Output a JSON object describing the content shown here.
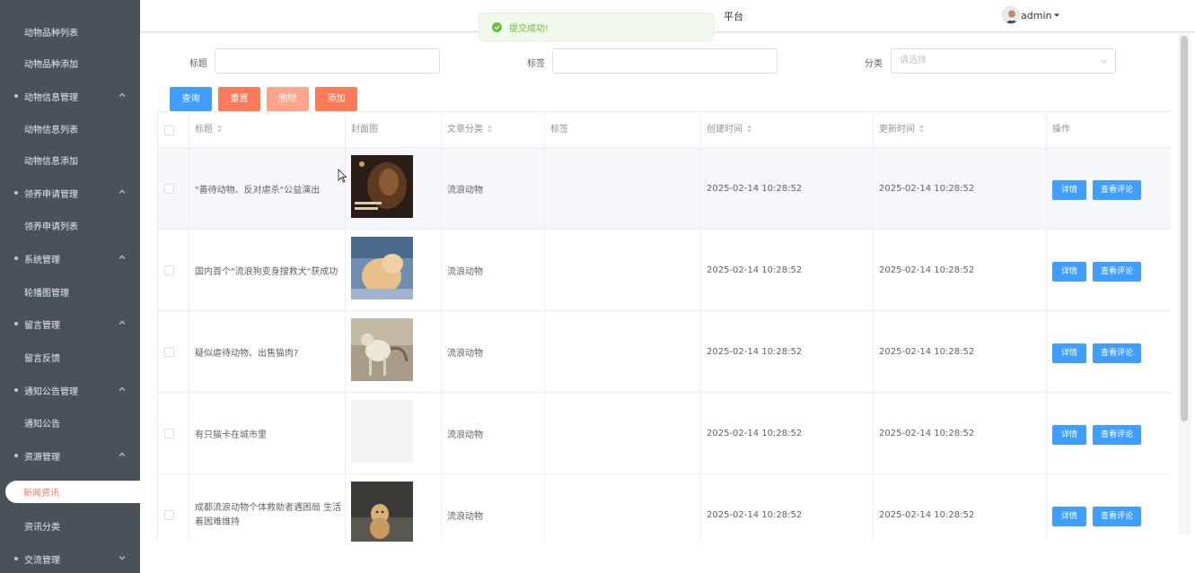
{
  "sidebar": {
    "items": [
      {
        "type": "sub",
        "label": "动物品种列表"
      },
      {
        "type": "sub",
        "label": "动物品种添加"
      },
      {
        "type": "group",
        "label": "动物信息管理"
      },
      {
        "type": "sub",
        "label": "动物信息列表"
      },
      {
        "type": "sub",
        "label": "动物信息添加"
      },
      {
        "type": "group",
        "label": "领养申请管理"
      },
      {
        "type": "sub",
        "label": "领养申请列表"
      },
      {
        "type": "group",
        "label": "系统管理"
      },
      {
        "type": "sub",
        "label": "轮播图管理"
      },
      {
        "type": "group",
        "label": "留言管理"
      },
      {
        "type": "sub",
        "label": "留言反馈"
      },
      {
        "type": "group",
        "label": "通知公告管理"
      },
      {
        "type": "sub",
        "label": "通知公告"
      },
      {
        "type": "group",
        "label": "资源管理"
      },
      {
        "type": "active",
        "label": "新闻资讯"
      },
      {
        "type": "sub",
        "label": "资讯分类"
      },
      {
        "type": "group",
        "label": "交流管理"
      }
    ]
  },
  "header": {
    "title": "平台",
    "username": "admin"
  },
  "toast": {
    "message": "提交成功!",
    "type": "success"
  },
  "search": {
    "title_label": "标题",
    "tag_label": "标签",
    "category_label": "分类",
    "category_placeholder": "请选择"
  },
  "actions": {
    "query": "查询",
    "reset": "重置",
    "delete": "删除",
    "add": "添加"
  },
  "table": {
    "columns": [
      "标题",
      "封面图",
      "文章分类",
      "标签",
      "创建时间",
      "更新时间",
      "操作"
    ],
    "rows": [
      {
        "title": "\"善待动物、反对虐杀\"公益演出",
        "category": "流浪动物",
        "tag": "",
        "created": "2025-02-14 10:28:52",
        "updated": "2025-02-14 10:28:52",
        "cover": "dark-poster"
      },
      {
        "title": "国内首个\"流浪狗变身搜救犬\"获成功",
        "category": "流浪动物",
        "tag": "",
        "created": "2025-02-14 10:28:52",
        "updated": "2025-02-14 10:28:52",
        "cover": "cat-photo"
      },
      {
        "title": "疑似虐待动物、出售猫肉?",
        "category": "流浪动物",
        "tag": "",
        "created": "2025-02-14 10:28:52",
        "updated": "2025-02-14 10:28:52",
        "cover": "cat-street"
      },
      {
        "title": "有只猫卡在城市里",
        "category": "流浪动物",
        "tag": "",
        "created": "2025-02-14 10:28:52",
        "updated": "2025-02-14 10:28:52",
        "cover": "none"
      },
      {
        "title": "成都流浪动物个体救助者遇困局 生活着困难维持",
        "category": "流浪动物",
        "tag": "",
        "created": "2025-02-14 10:28:52",
        "updated": "2025-02-14 10:28:52",
        "cover": "dog-photo"
      }
    ],
    "detail_label": "详情",
    "comment_label": "查看评论"
  },
  "colors": {
    "sidebar_bg": "#4a5259",
    "primary": "#409eff",
    "danger": "#fa7a5a",
    "active_text": "#f07a5a",
    "success": "#67c23a"
  }
}
